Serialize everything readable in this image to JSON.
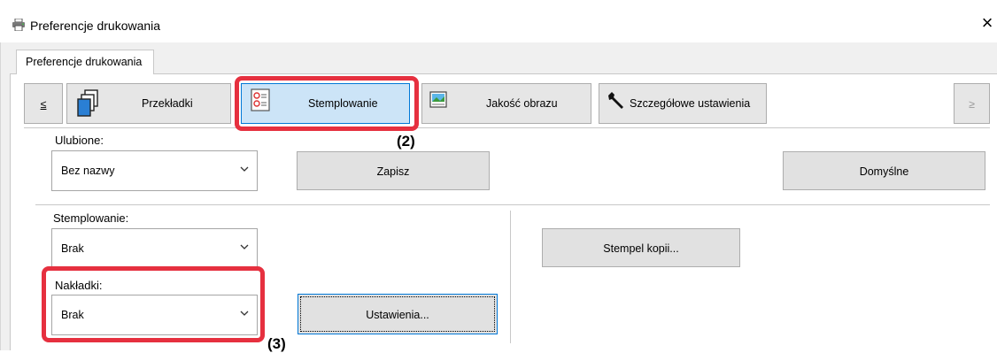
{
  "window": {
    "title": "Preferencje drukowania",
    "close_glyph": "×",
    "app_icon": "printer-icon"
  },
  "tabs": [
    {
      "label": "Preferencje drukowania",
      "active": true
    }
  ],
  "toolbar": {
    "prev_glyph": "≤",
    "next_glyph": "≥",
    "items": [
      {
        "label": "Przekładki",
        "icon": "pages-icon",
        "selected": false
      },
      {
        "label": "Stemplowanie",
        "icon": "stamp-icon",
        "selected": true
      },
      {
        "label": "Jakość obrazu",
        "icon": "image-quality-icon",
        "selected": false
      },
      {
        "label": "Szczegółowe ustawienia",
        "icon": "wrench-icon",
        "selected": false
      }
    ]
  },
  "favorites": {
    "label": "Ulubione:",
    "value": "Bez nazwy",
    "save_label": "Zapisz",
    "default_label": "Domyślne"
  },
  "stamping": {
    "label": "Stemplowanie:",
    "value": "Brak",
    "copy_stamp_label": "Stempel kopii..."
  },
  "overlays": {
    "label": "Nakładki:",
    "value": "Brak",
    "settings_label": "Ustawienia..."
  },
  "callouts": {
    "step2": "(2)",
    "step3": "(3)"
  },
  "colors": {
    "highlight": "#e6303f",
    "selected_bg": "#cce4f7",
    "selected_border": "#0078d7"
  }
}
